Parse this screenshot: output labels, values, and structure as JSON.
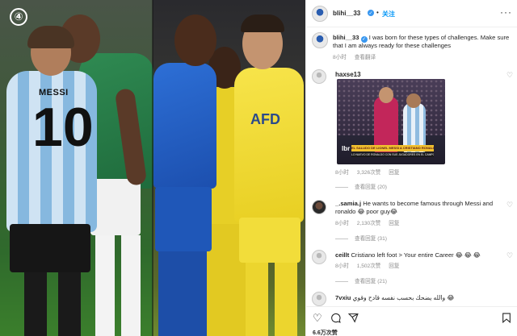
{
  "media": {
    "badge": "④",
    "jersey_name": "MESSI",
    "jersey_number": "10",
    "club_text": "AFD"
  },
  "post": {
    "username": "blihi__33",
    "verified_icon": "verified-badge-icon",
    "separator": "•",
    "follow_label": "关注",
    "more_icon": "more-horizontal-icon",
    "caption_username": "blihi__33",
    "caption_text": "I was born for these types of challenges. Make sure that I am always ready for these challenges",
    "caption_time": "8小时",
    "caption_translate": "查看翻译"
  },
  "comments": [
    {
      "username": "haxse13",
      "text": "",
      "time": "8小时",
      "likes": "3,326次赞",
      "reply": "回复",
      "view_replies": "查看回复 (20)",
      "image": {
        "logo": "lbr",
        "caption": "EL SALUDO DE LIONEL MESSI A CRISTIANO RONALDO",
        "sub": "LO NUEVO DE RONALDO CON SUS JUGADORES EN EL CAMPO"
      }
    },
    {
      "username": "_.samia.j",
      "text": "He wants to become famous through Messi and ronaldo 😂 poor guy😂",
      "time": "8小时",
      "likes": "2,130次赞",
      "reply": "回复",
      "view_replies": "查看回复 (31)"
    },
    {
      "username": "ceillt",
      "text": "Cristiano left foot > Your entire Career 😂 😂 😂",
      "time": "8小时",
      "likes": "1,502次赞",
      "reply": "回复",
      "view_replies": "查看回复 (21)"
    },
    {
      "username": "7vxiu",
      "text": "والله يضحك بحسب نفسه قادح وقوي 😂"
    }
  ],
  "footer": {
    "like_icon": "heart-icon",
    "comment_icon": "comment-icon",
    "share_icon": "share-icon",
    "save_icon": "bookmark-icon",
    "likes": "6.6万次赞"
  },
  "colors": {
    "link": "#0095f6",
    "verified": "#3897f0",
    "muted": "#8e8e8e",
    "text": "#262626"
  }
}
